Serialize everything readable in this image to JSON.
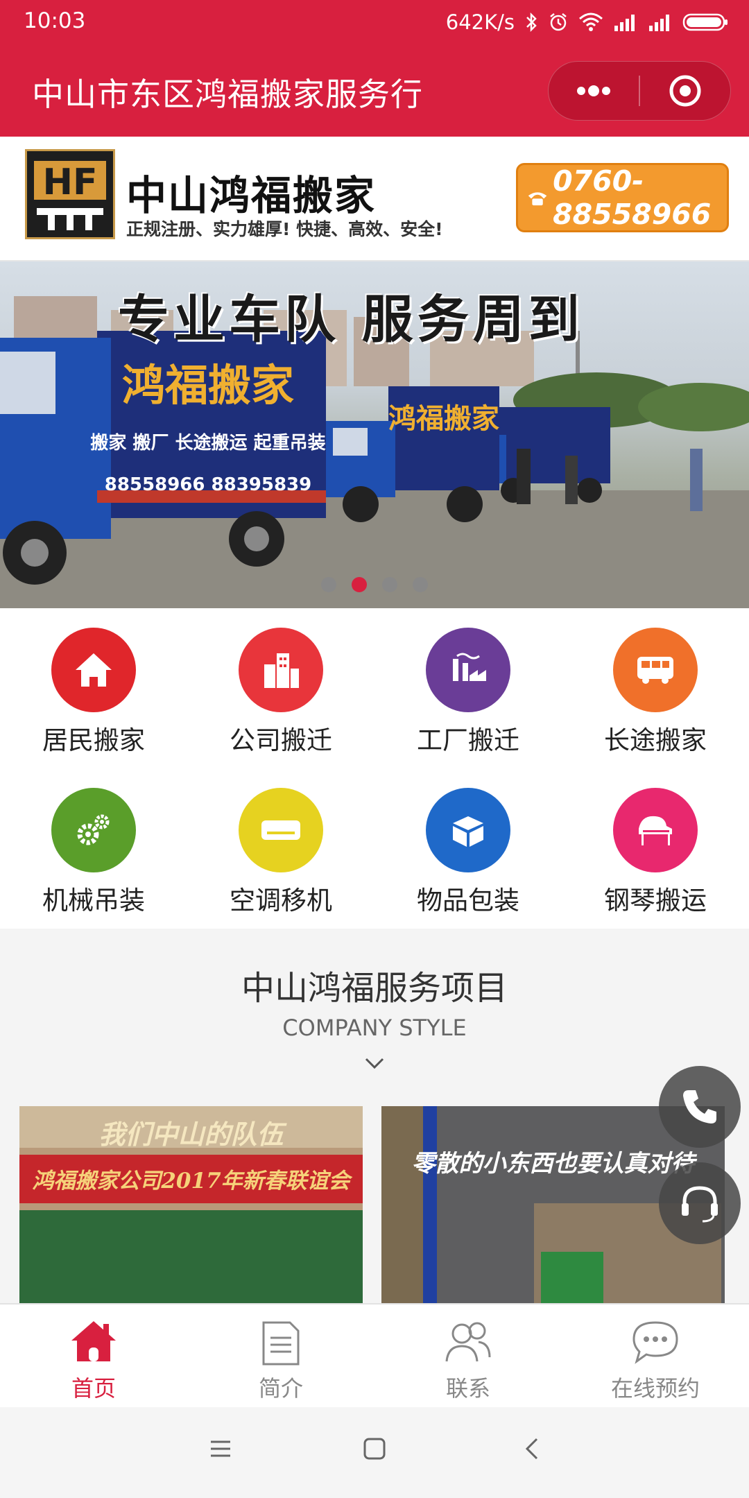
{
  "status_bar": {
    "time": "10:03",
    "net_speed": "642K/s"
  },
  "title_bar": {
    "title": "中山市东区鸿福搬家服务行",
    "more_icon": "more-dots-icon",
    "close_icon": "target-icon"
  },
  "brand": {
    "logo_text": "HF",
    "name": "中山鸿福搬家",
    "slogan": "正规注册、实力雄厚! 快捷、高效、安全!",
    "phone": "0760-88558966"
  },
  "hero": {
    "headline": "专业车队 服务周到",
    "truck_brand": "鸿福搬家",
    "truck_services": "搬家 搬厂 长途搬运 起重吊装",
    "truck_phones": "88558966 88395839",
    "slide_count": 4,
    "active_slide": 2
  },
  "categories": [
    {
      "label": "居民搬家",
      "icon": "house-icon",
      "color": "#e0262b"
    },
    {
      "label": "公司搬迁",
      "icon": "building-icon",
      "color": "#e8353b"
    },
    {
      "label": "工厂搬迁",
      "icon": "factory-icon",
      "color": "#6a3d97"
    },
    {
      "label": "长途搬家",
      "icon": "bus-icon",
      "color": "#f0702a"
    },
    {
      "label": "机械吊装",
      "icon": "gears-icon",
      "color": "#5a9e2a"
    },
    {
      "label": "空调移机",
      "icon": "air-conditioner-icon",
      "color": "#e6d220"
    },
    {
      "label": "物品包装",
      "icon": "box-icon",
      "color": "#1f69c9"
    },
    {
      "label": "钢琴搬运",
      "icon": "piano-icon",
      "color": "#e8286e"
    }
  ],
  "section": {
    "title": "中山鸿福服务项目",
    "subtitle": "COMPANY STYLE",
    "photo1_caption": "我们中山的队伍",
    "photo1_banner": "鸿福搬家公司2017年新春联谊会",
    "photo2_caption": "零散的小东西也要认真对待"
  },
  "floating": {
    "phone_icon": "phone-icon",
    "support_icon": "headset-icon"
  },
  "tabs": [
    {
      "label": "首页",
      "icon": "home-icon",
      "active": true
    },
    {
      "label": "简介",
      "icon": "document-icon",
      "active": false
    },
    {
      "label": "联系",
      "icon": "contacts-icon",
      "active": false
    },
    {
      "label": "在线预约",
      "icon": "chat-bubble-icon",
      "active": false
    }
  ],
  "colors": {
    "primary": "#d8203f",
    "tab_inactive": "#888888"
  }
}
